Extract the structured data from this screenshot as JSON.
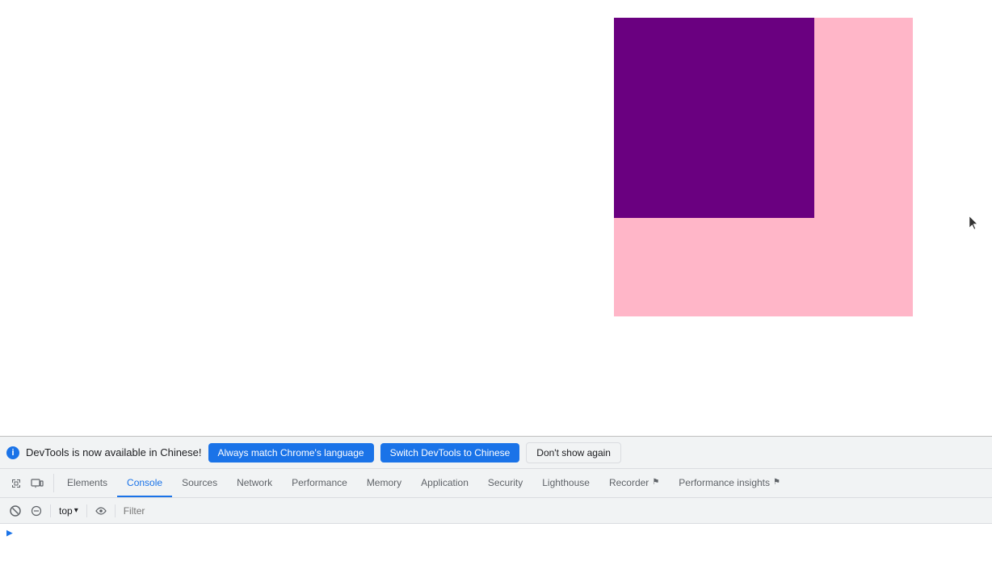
{
  "browser": {
    "colors": {
      "purple": "#6a0080",
      "pink": "#ffb6c8",
      "white": "#ffffff"
    }
  },
  "notification": {
    "info_text": "DevTools is now available in Chinese!",
    "btn_always_match": "Always match Chrome's language",
    "btn_switch_chinese": "Switch DevTools to Chinese",
    "btn_dont_show": "Don't show again"
  },
  "tabs": [
    {
      "id": "elements",
      "label": "Elements",
      "active": false
    },
    {
      "id": "console",
      "label": "Console",
      "active": true
    },
    {
      "id": "sources",
      "label": "Sources",
      "active": false
    },
    {
      "id": "network",
      "label": "Network",
      "active": false
    },
    {
      "id": "performance",
      "label": "Performance",
      "active": false
    },
    {
      "id": "memory",
      "label": "Memory",
      "active": false
    },
    {
      "id": "application",
      "label": "Application",
      "active": false
    },
    {
      "id": "security",
      "label": "Security",
      "active": false
    },
    {
      "id": "lighthouse",
      "label": "Lighthouse",
      "active": false
    },
    {
      "id": "recorder",
      "label": "Recorder",
      "active": false
    },
    {
      "id": "performance-insights",
      "label": "Performance insights",
      "active": false
    }
  ],
  "console_toolbar": {
    "context_selector": "top",
    "filter_placeholder": "Filter"
  },
  "icons": {
    "inspect": "⬡",
    "toggle_device": "▭",
    "error": "⊘",
    "eye": "👁",
    "chevron_down": "▾",
    "caret_right": "▶",
    "flag": "⚑"
  }
}
